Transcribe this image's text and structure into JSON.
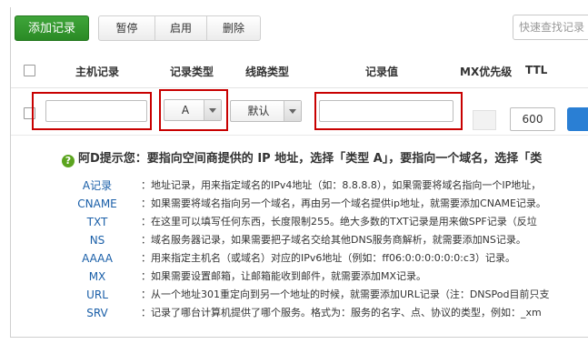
{
  "toolbar": {
    "add_label": "添加记录",
    "pause_label": "暂停",
    "enable_label": "启用",
    "delete_label": "删除",
    "search_placeholder": "快速查找记录"
  },
  "table": {
    "headers": [
      "主机记录",
      "记录类型",
      "线路类型",
      "记录值",
      "MX优先级",
      "TTL"
    ]
  },
  "edit_row": {
    "host_value": "",
    "type_value": "A",
    "line_value": "默认",
    "record_value": "",
    "mx_value": "",
    "ttl_value": "600"
  },
  "hint": {
    "text": "阿D提示您：要指向空间商提供的 IP 地址，选择「类型 A」，要指向一个域名，选择「类"
  },
  "record_types": [
    {
      "name": "A记录",
      "desc": "：地址记录，用来指定域名的IPv4地址（如：8.8.8.8），如果需要将域名指向一个IP地址，"
    },
    {
      "name": "CNAME",
      "desc": "：如果需要将域名指向另一个域名，再由另一个域名提供ip地址，就需要添加CNAME记录。"
    },
    {
      "name": "TXT",
      "desc": "：在这里可以填写任何东西，长度限制255。绝大多数的TXT记录是用来做SPF记录（反垃"
    },
    {
      "name": "NS",
      "desc": "：域名服务器记录，如果需要把子域名交给其他DNS服务商解析，就需要添加NS记录。"
    },
    {
      "name": "AAAA",
      "desc": "：用来指定主机名（或域名）对应的IPv6地址（例如：ff06:0:0:0:0:0:0:c3）记录。"
    },
    {
      "name": "MX",
      "desc": "：如果需要设置邮箱，让邮箱能收到邮件，就需要添加MX记录。"
    },
    {
      "name": "URL",
      "desc": "：从一个地址301重定向到另一个地址的时候，就需要添加URL记录（注：DNSPod目前只支"
    },
    {
      "name": "SRV",
      "desc": "：记录了哪台计算机提供了哪个服务。格式为：服务的名字、点、协议的类型，例如：_xm"
    }
  ],
  "colors": {
    "add_button": "#2f9a2a",
    "highlight_border": "#c80000",
    "type_name": "#1a5fa8",
    "save_button": "#2a7fd4"
  }
}
